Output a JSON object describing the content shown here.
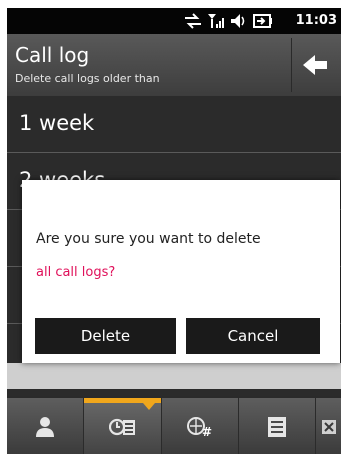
{
  "status_bar": {
    "time": "11:03"
  },
  "header": {
    "title": "Call log",
    "subtitle": "Delete call logs older than"
  },
  "list": {
    "items": [
      {
        "label": "1 week"
      },
      {
        "label": "2 weeks"
      }
    ]
  },
  "dialog": {
    "question": "Are you sure you want to delete",
    "highlight": "all call logs?",
    "buttons": {
      "delete": "Delete",
      "cancel": "Cancel"
    }
  },
  "tabs": [
    {
      "icon": "contact-icon",
      "active": false
    },
    {
      "icon": "call-log-icon",
      "active": true
    },
    {
      "icon": "dialer-icon",
      "active": false
    },
    {
      "icon": "menu-icon",
      "active": false
    },
    {
      "icon": "close-icon",
      "active": false
    }
  ],
  "colors": {
    "accent": "#f1a71c",
    "highlight_text": "#e0105a"
  }
}
